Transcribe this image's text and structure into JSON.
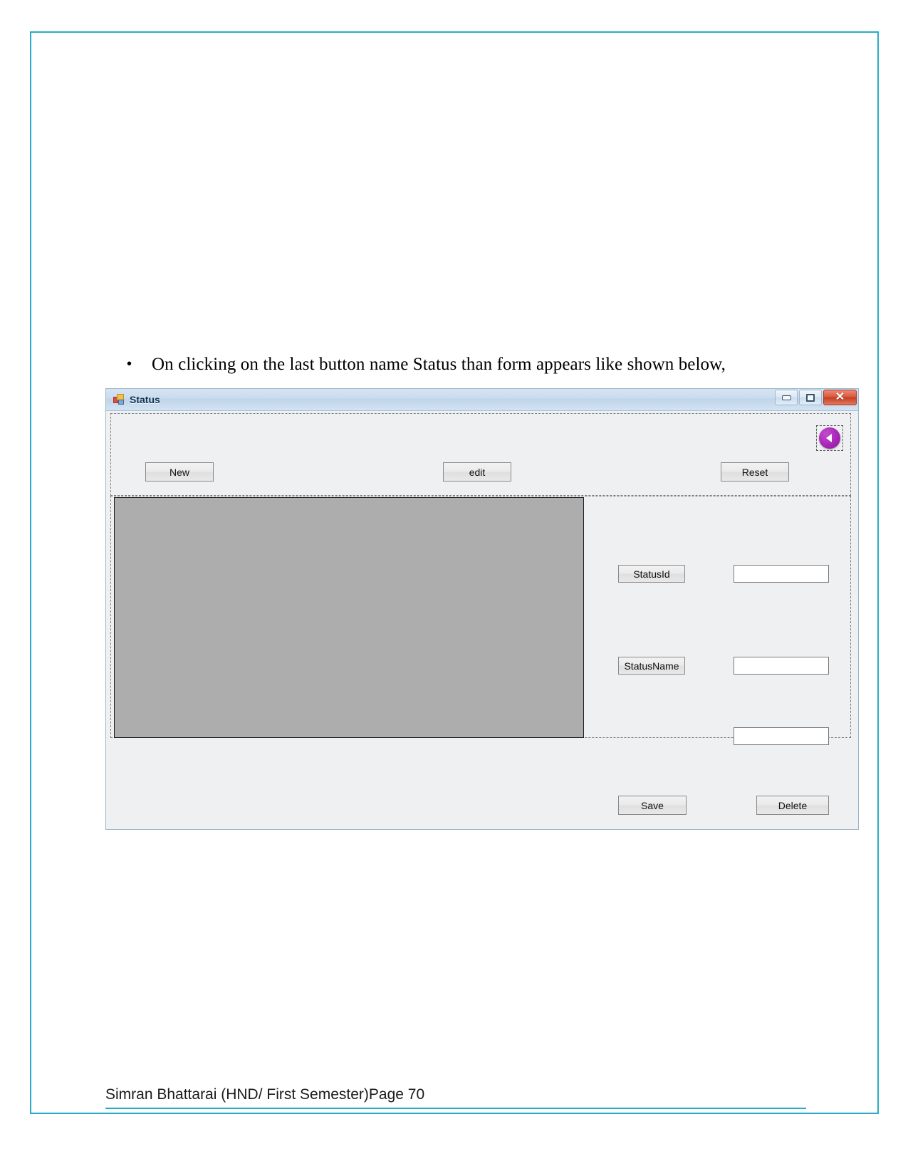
{
  "document": {
    "bullet_marker": "•",
    "bullet_text": "On clicking on the last button name Status than form appears like shown below,",
    "footer_text": "Simran Bhattarai (HND/ First Semester)Page 70",
    "border_color": "#29ABC8",
    "footer_rule_color": "#29ABC8"
  },
  "window": {
    "title": "Status",
    "icon": "winforms-icon",
    "controls": {
      "minimize_label": "",
      "maximize_label": "",
      "close_label": "✕"
    },
    "titlebar_color": "#cadcee",
    "client_bg": "#eff0f1"
  },
  "top_panel": {
    "buttons": [
      {
        "name": "new",
        "label": "New"
      },
      {
        "name": "edit",
        "label": "edit"
      },
      {
        "name": "reset",
        "label": "Reset"
      }
    ],
    "back_button": {
      "label": "",
      "icon": "chevron-left-icon",
      "color": "#a726b6"
    }
  },
  "bottom_panel": {
    "datagrid": {
      "rows": [],
      "columns": [],
      "background": "#adadad"
    },
    "fields": [
      {
        "name": "statusid",
        "label": "StatusId",
        "value": "",
        "placeholder": ""
      },
      {
        "name": "statusname",
        "label": "StatusName",
        "value": "",
        "placeholder": ""
      },
      {
        "name": "extra",
        "label": "",
        "value": "",
        "placeholder": ""
      }
    ],
    "actions": [
      {
        "name": "save",
        "label": "Save"
      },
      {
        "name": "delete",
        "label": "Delete"
      }
    ]
  }
}
